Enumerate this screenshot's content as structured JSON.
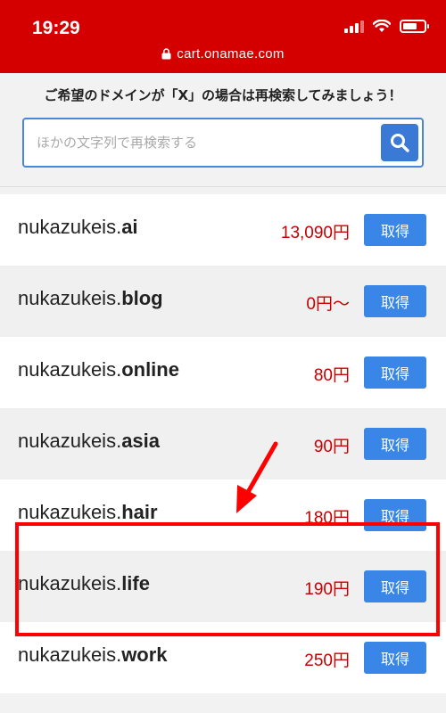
{
  "status_bar": {
    "time": "19:29",
    "url": "cart.onamae.com"
  },
  "search": {
    "hint": "ご希望のドメインが「X」の場合は再検索してみましょう！",
    "placeholder": "ほかの文字列で再検索する"
  },
  "domains": [
    {
      "name": "nukazukeis.",
      "tld": "ai",
      "price": "13,090円",
      "button": "取得"
    },
    {
      "name": "nukazukeis.",
      "tld": "blog",
      "price": "0円〜",
      "button": "取得"
    },
    {
      "name": "nukazukeis.",
      "tld": "online",
      "price": "80円",
      "button": "取得"
    },
    {
      "name": "nukazukeis.",
      "tld": "asia",
      "price": "90円",
      "button": "取得"
    },
    {
      "name": "nukazukeis.",
      "tld": "hair",
      "price": "180円",
      "button": "取得"
    },
    {
      "name": "nukazukeis.",
      "tld": "life",
      "price": "190円",
      "button": "取得"
    },
    {
      "name": "nukazukeis.",
      "tld": "work",
      "price": "250円",
      "button": "取得"
    }
  ],
  "colors": {
    "header": "#d40000",
    "price": "#c70000",
    "button": "#3a86e6",
    "annotation": "#ff0000"
  }
}
